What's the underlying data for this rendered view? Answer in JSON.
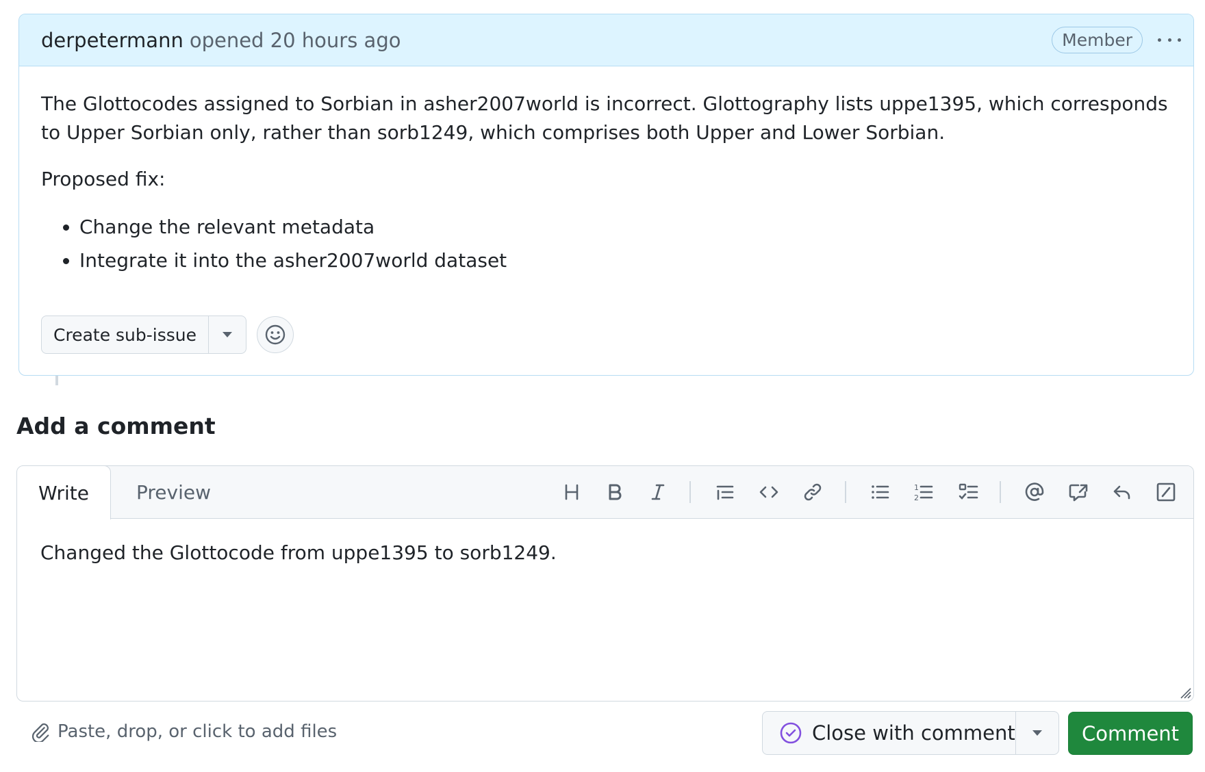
{
  "issue": {
    "author": "derpetermann",
    "opened_text": "opened 20 hours ago",
    "badge": "Member",
    "body": {
      "paragraph1": "The Glottocodes assigned to Sorbian in asher2007world is incorrect. Glottography lists uppe1395, which corresponds to Upper Sorbian only, rather than sorb1249, which comprises both Upper and Lower Sorbian.",
      "paragraph2": "Proposed fix:",
      "list": [
        "Change the relevant metadata",
        "Integrate it into the asher2007world dataset"
      ]
    },
    "create_sub_issue_label": "Create sub-issue"
  },
  "comment": {
    "title": "Add a comment",
    "tabs": {
      "write": "Write",
      "preview": "Preview"
    },
    "toolbar_icons": [
      "heading-icon",
      "bold-icon",
      "italic-icon",
      "quote-icon",
      "code-icon",
      "link-icon",
      "unordered-list-icon",
      "ordered-list-icon",
      "task-list-icon",
      "mention-icon",
      "cross-reference-icon",
      "reply-icon",
      "slash-commands-icon"
    ],
    "text": "Changed the Glottocode from uppe1395 to sorb1249.",
    "attach_label": "Paste, drop, or click to add files",
    "close_label": "Close with comment",
    "submit_label": "Comment"
  },
  "colors": {
    "header_bg": "#ddf4ff",
    "accent_green": "#1f883d",
    "close_icon": "#8250df"
  }
}
